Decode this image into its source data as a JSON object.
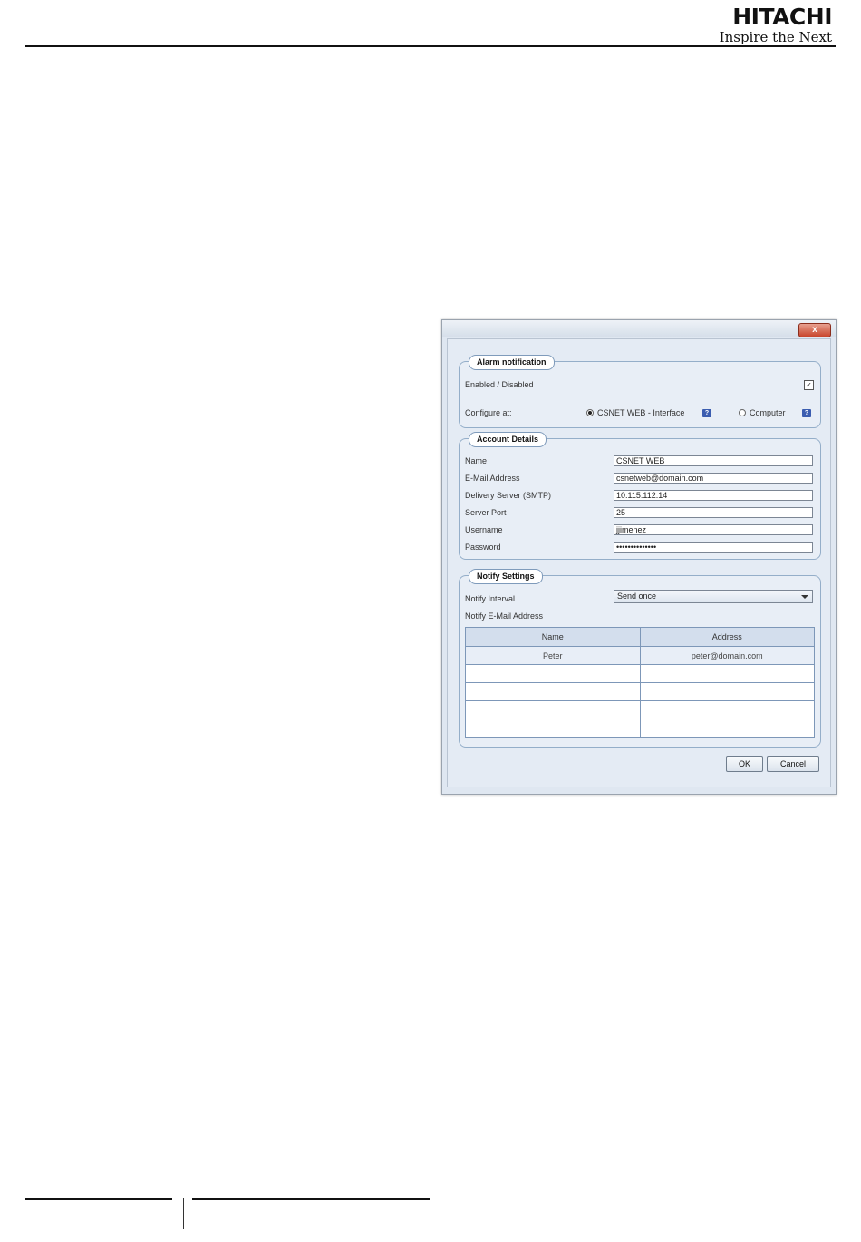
{
  "header": {
    "brand": "HITACHI",
    "tagline": "Inspire the Next"
  },
  "dialog": {
    "close_glyph": "x",
    "alarm": {
      "title": "Alarm notification",
      "enabled_label": "Enabled / Disabled",
      "enabled_checked": true,
      "configure_label": "Configure at:",
      "options": [
        {
          "label": "CSNET WEB - Interface",
          "selected": true
        },
        {
          "label": "Computer",
          "selected": false
        }
      ]
    },
    "account": {
      "title": "Account Details",
      "fields": [
        {
          "label": "Name",
          "value": "CSNET WEB"
        },
        {
          "label": "E-Mail Address",
          "value": "csnetweb@domain.com"
        },
        {
          "label": "Delivery Server (SMTP)",
          "value": "10.115.112.14"
        },
        {
          "label": "Server Port",
          "value": "25"
        },
        {
          "label": "Username",
          "value": "jjimenez"
        },
        {
          "label": "Password",
          "value": "••••••••••••••"
        }
      ]
    },
    "notify": {
      "title": "Notify Settings",
      "interval_label": "Notify Interval",
      "interval_value": "Send once",
      "email_label": "Notify E-Mail Address",
      "columns": [
        "Name",
        "Address"
      ],
      "rows": [
        {
          "name": "Peter",
          "address": "peter@domain.com"
        }
      ]
    },
    "buttons": {
      "ok": "OK",
      "cancel": "Cancel"
    }
  }
}
